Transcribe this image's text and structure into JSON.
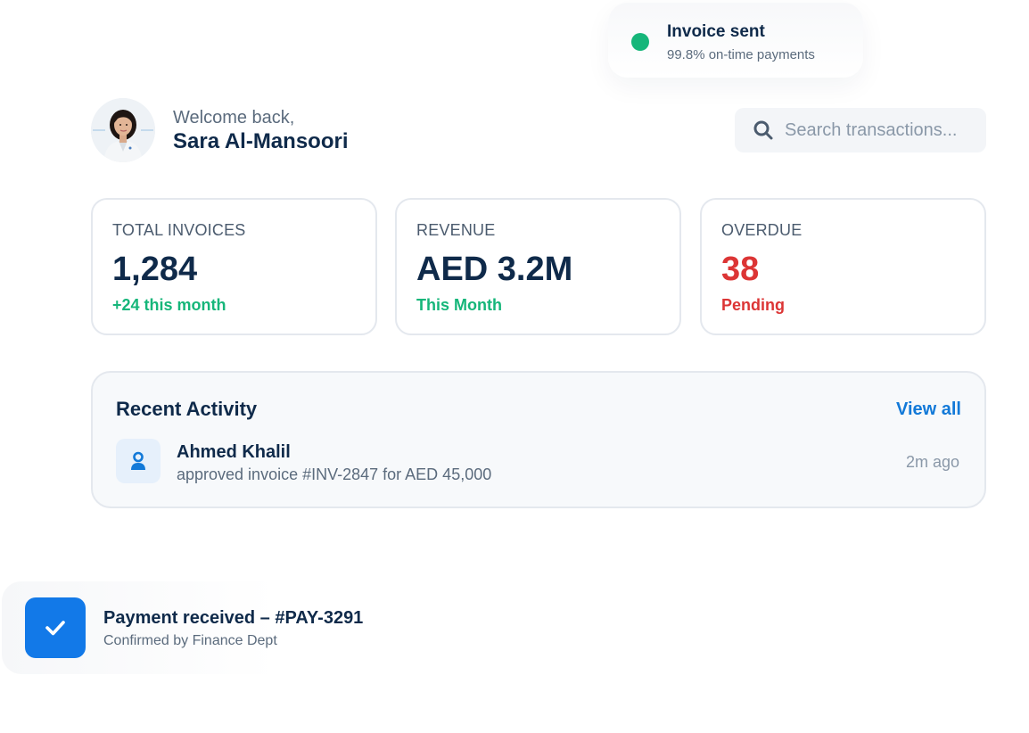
{
  "toast_invoice": {
    "title": "Invoice sent",
    "subtitle": "99.8% on-time payments",
    "status_color": "#16b67a",
    "icon": "status-dot-icon"
  },
  "header": {
    "greeting": "Welcome back,",
    "user_name": "Sara Al-Mansoori",
    "avatar_icon": "user-avatar"
  },
  "search": {
    "placeholder": "Search transactions...",
    "value": "",
    "icon": "search-icon"
  },
  "stats": [
    {
      "label": "TOTAL INVOICES",
      "value": "1,284",
      "sub": "+24 this month",
      "sub_color": "#16b67a",
      "value_color": "#0f2a4a"
    },
    {
      "label": "REVENUE",
      "value": "AED 3.2M",
      "sub": "This Month",
      "sub_color": "#16b67a",
      "value_color": "#0f2a4a"
    },
    {
      "label": "OVERDUE",
      "value": "38",
      "sub": "Pending",
      "sub_color": "#dc3535",
      "value_color": "#dc3535"
    }
  ],
  "activity": {
    "title": "Recent Activity",
    "view_all_label": "View all",
    "items": [
      {
        "name": "Ahmed Khalil",
        "description": "approved invoice #INV-2847 for AED 45,000",
        "time": "2m ago",
        "icon": "user-icon"
      }
    ]
  },
  "toast_payment": {
    "title": "Payment received – #PAY-3291",
    "subtitle": "Confirmed by Finance Dept",
    "icon": "checkmark-icon",
    "accent_color": "#1279e8"
  },
  "colors": {
    "primary_text": "#0f2a4a",
    "muted_text": "#5b6b7d",
    "accent_blue": "#1279d8",
    "success": "#16b67a",
    "danger": "#dc3535"
  }
}
